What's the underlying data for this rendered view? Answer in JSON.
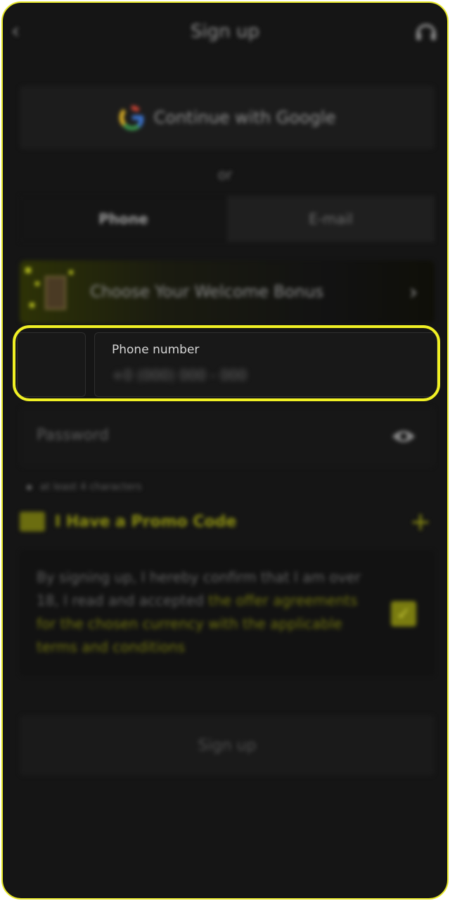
{
  "header": {
    "title": "Sign up"
  },
  "social": {
    "google_label": "Continue with Google",
    "or_text": "or"
  },
  "tabs": [
    {
      "label": "Phone",
      "active": true
    },
    {
      "label": "E-mail",
      "active": false
    }
  ],
  "bonus": {
    "label": "Choose Your Welcome Bonus"
  },
  "phone": {
    "label": "Phone number",
    "placeholder": "+0 (000) 000 - 000"
  },
  "password": {
    "placeholder": "Password",
    "hint": "at least 4 characters"
  },
  "promo": {
    "label": "I Have a Promo Code"
  },
  "terms": {
    "text": "By signing up, I hereby confirm that I am over 18, I read and accepted ",
    "link": "the offer agreements for the chosen currency with the applicable terms and conditions",
    "checked": true
  },
  "submit": {
    "label": "Sign up"
  },
  "colors": {
    "accent": "#e8e82a",
    "background": "#151515"
  }
}
